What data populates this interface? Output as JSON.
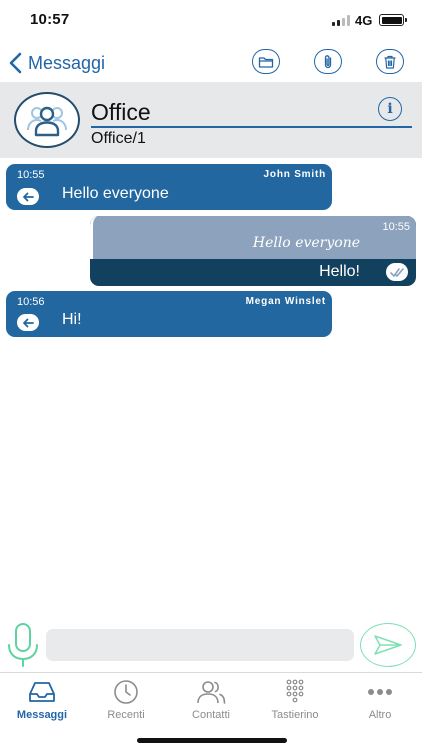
{
  "status_bar": {
    "time": "10:57",
    "network": "4G"
  },
  "nav": {
    "back_label": "Messaggi"
  },
  "contact": {
    "name": "Office",
    "subtitle": "Office/1",
    "info_glyph": "i"
  },
  "messages": [
    {
      "direction": "incoming",
      "time": "10:55",
      "sender": "John  Smith",
      "text": "Hello everyone"
    },
    {
      "direction": "outgoing",
      "quoted_time": "10:55",
      "quoted_text": "Hello everyone",
      "text": "Hello!",
      "status": "read"
    },
    {
      "direction": "incoming",
      "time": "10:56",
      "sender": "Megan  Winslet",
      "text": "Hi!"
    }
  ],
  "composer": {
    "placeholder": ""
  },
  "tabs": [
    {
      "label": "Messaggi",
      "icon": "inbox-icon",
      "active": true
    },
    {
      "label": "Recenti",
      "icon": "clock-icon",
      "active": false
    },
    {
      "label": "Contatti",
      "icon": "contacts-icon",
      "active": false
    },
    {
      "label": "Tastierino",
      "icon": "keypad-icon",
      "active": false
    },
    {
      "label": "Altro",
      "icon": "more-icon",
      "active": false
    }
  ],
  "colors": {
    "accent": "#2266a6",
    "incoming_bubble": "#2267a0",
    "outgoing_bubble": "#12405f",
    "quote_block": "#8da2bc",
    "header_bg": "#e6e8ea",
    "mic_send": "#7fe0b5",
    "tab_inactive": "#8c8c8c"
  }
}
